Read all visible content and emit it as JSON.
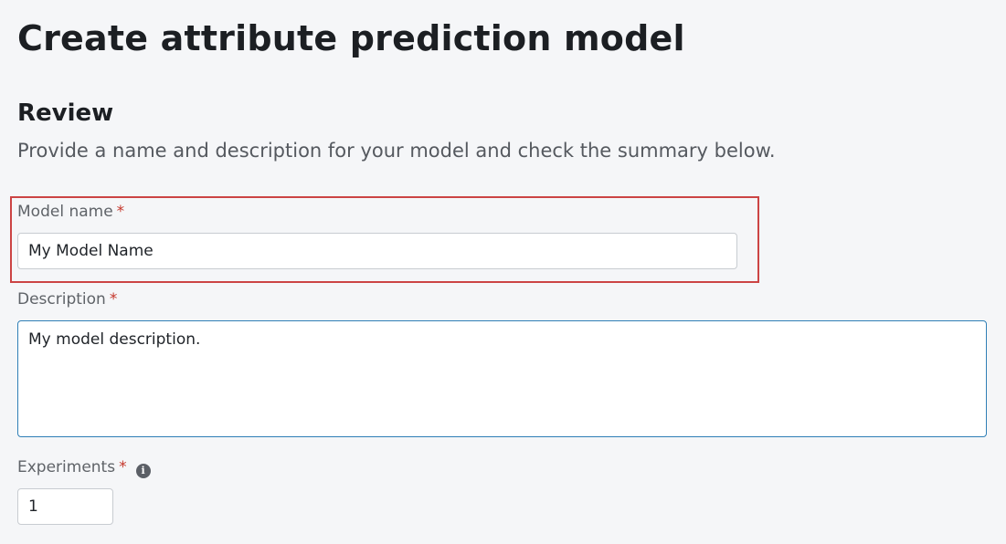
{
  "page": {
    "title": "Create attribute prediction model"
  },
  "review": {
    "title": "Review",
    "description": "Provide a name and description for your model and check the summary below."
  },
  "fields": {
    "model_name": {
      "label": "Model name",
      "required_marker": "*",
      "value": "My Model Name"
    },
    "description": {
      "label": "Description",
      "required_marker": "*",
      "value": "My model description."
    },
    "experiments": {
      "label": "Experiments",
      "required_marker": "*",
      "info_icon": "info-icon",
      "value": "1"
    }
  },
  "colors": {
    "highlight_border": "#cc4444",
    "required": "#c5372c",
    "focus_border": "#2f7fb6"
  }
}
